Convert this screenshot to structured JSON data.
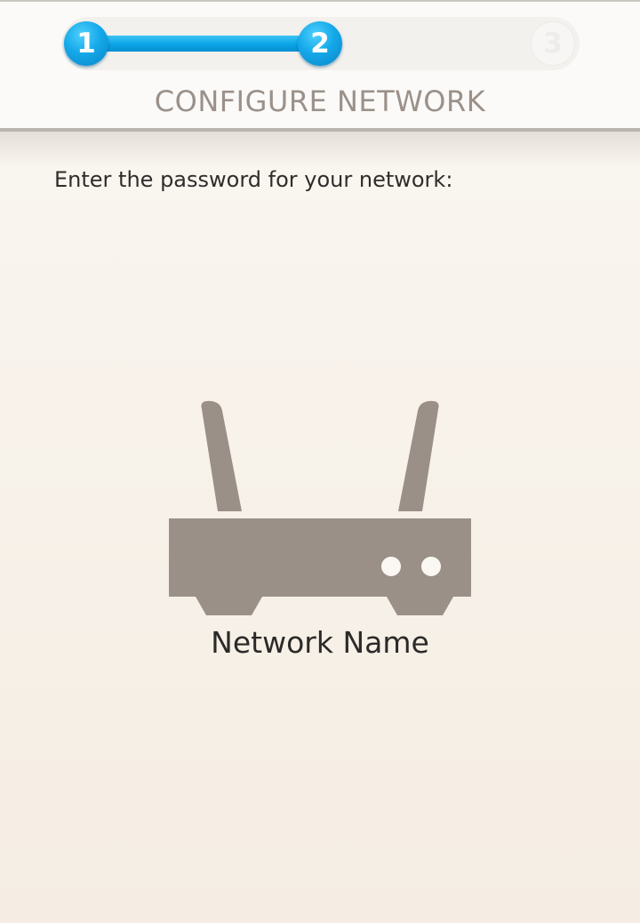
{
  "stepper": {
    "steps": [
      {
        "label": "1",
        "state": "completed"
      },
      {
        "label": "2",
        "state": "current"
      },
      {
        "label": "3",
        "state": "upcoming"
      }
    ],
    "current_step": 2,
    "total_steps": 3
  },
  "header": {
    "title": "CONFIGURE NETWORK"
  },
  "main": {
    "prompt": "Enter the password for your network:",
    "router_icon": "wifi-router-icon",
    "network_name": "Network Name"
  },
  "colors": {
    "accent": "#0aa4e6",
    "title_text": "#9b918a",
    "icon": "#9a9087",
    "background": "#f6efe6"
  }
}
